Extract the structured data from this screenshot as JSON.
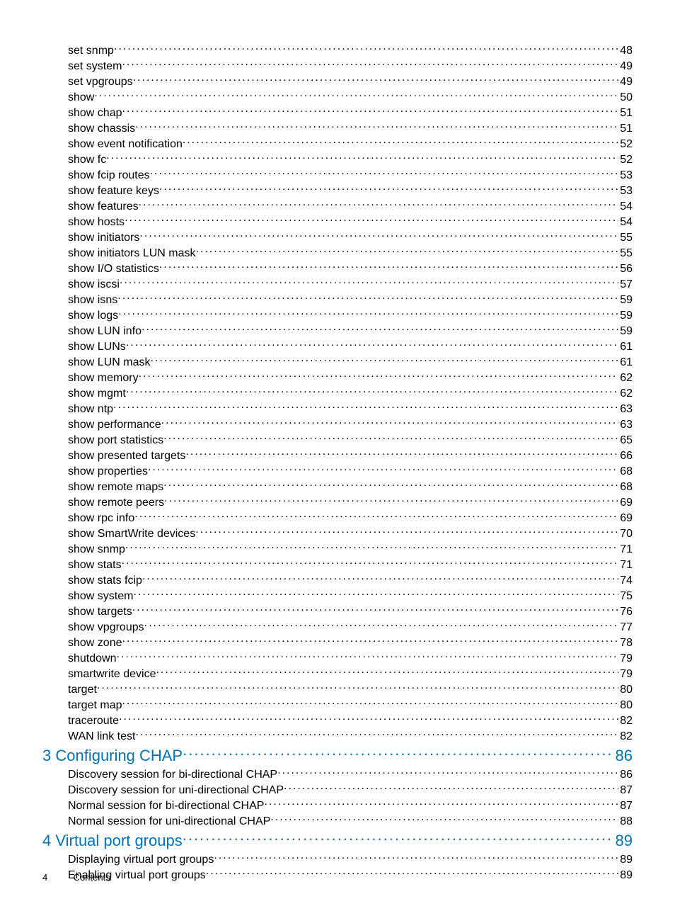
{
  "footer": {
    "page_number": "4",
    "section": "Contents"
  },
  "toc": [
    {
      "level": 1,
      "title": "set snmp",
      "page": "48"
    },
    {
      "level": 1,
      "title": "set system",
      "page": "49"
    },
    {
      "level": 1,
      "title": "set vpgroups",
      "page": "49"
    },
    {
      "level": 1,
      "title": "show",
      "page": "50"
    },
    {
      "level": 1,
      "title": "show chap",
      "page": "51"
    },
    {
      "level": 1,
      "title": "show chassis",
      "page": "51"
    },
    {
      "level": 1,
      "title": "show event notification",
      "page": "52"
    },
    {
      "level": 1,
      "title": "show fc",
      "page": "52"
    },
    {
      "level": 1,
      "title": "show fcip routes",
      "page": "53"
    },
    {
      "level": 1,
      "title": "show feature keys",
      "page": "53"
    },
    {
      "level": 1,
      "title": "show features",
      "page": "54"
    },
    {
      "level": 1,
      "title": "show hosts",
      "page": "54"
    },
    {
      "level": 1,
      "title": "show initiators",
      "page": "55"
    },
    {
      "level": 1,
      "title": "show initiators LUN mask",
      "page": "55"
    },
    {
      "level": 1,
      "title": "show I/O statistics",
      "page": "56"
    },
    {
      "level": 1,
      "title": "show iscsi",
      "page": "57"
    },
    {
      "level": 1,
      "title": "show isns",
      "page": "59"
    },
    {
      "level": 1,
      "title": "show logs",
      "page": "59"
    },
    {
      "level": 1,
      "title": "show LUN info",
      "page": "59"
    },
    {
      "level": 1,
      "title": "show LUNs",
      "page": "61"
    },
    {
      "level": 1,
      "title": "show LUN mask",
      "page": "61"
    },
    {
      "level": 1,
      "title": "show memory",
      "page": "62"
    },
    {
      "level": 1,
      "title": "show mgmt",
      "page": "62"
    },
    {
      "level": 1,
      "title": "show ntp",
      "page": "63"
    },
    {
      "level": 1,
      "title": "show performance",
      "page": "63"
    },
    {
      "level": 1,
      "title": "show port statistics",
      "page": "65"
    },
    {
      "level": 1,
      "title": "show presented targets",
      "page": "66"
    },
    {
      "level": 1,
      "title": "show properties",
      "page": "68"
    },
    {
      "level": 1,
      "title": "show remote maps",
      "page": "68"
    },
    {
      "level": 1,
      "title": "show remote peers",
      "page": "69"
    },
    {
      "level": 1,
      "title": "show rpc info",
      "page": "69"
    },
    {
      "level": 1,
      "title": "show SmartWrite devices",
      "page": "70"
    },
    {
      "level": 1,
      "title": "show snmp",
      "page": "71"
    },
    {
      "level": 1,
      "title": "show stats",
      "page": "71"
    },
    {
      "level": 1,
      "title": "show stats fcip",
      "page": "74"
    },
    {
      "level": 1,
      "title": "show system",
      "page": "75"
    },
    {
      "level": 1,
      "title": "show targets",
      "page": "76"
    },
    {
      "level": 1,
      "title": "show vpgroups",
      "page": "77"
    },
    {
      "level": 1,
      "title": "show zone",
      "page": "78"
    },
    {
      "level": 1,
      "title": "shutdown",
      "page": "79"
    },
    {
      "level": 1,
      "title": "smartwrite device",
      "page": "79"
    },
    {
      "level": 1,
      "title": "target",
      "page": "80"
    },
    {
      "level": 1,
      "title": "target map",
      "page": "80"
    },
    {
      "level": 1,
      "title": "traceroute",
      "page": "82"
    },
    {
      "level": 1,
      "title": "WAN link test",
      "page": "82"
    },
    {
      "level": 0,
      "title": "3 Configuring CHAP",
      "page": "86"
    },
    {
      "level": 1,
      "title": "Discovery session for bi-directional CHAP",
      "page": "86"
    },
    {
      "level": 1,
      "title": "Discovery session for uni-directional CHAP",
      "page": "87"
    },
    {
      "level": 1,
      "title": "Normal session for bi-directional CHAP",
      "page": "87"
    },
    {
      "level": 1,
      "title": "Normal session for uni-directional CHAP",
      "page": "88"
    },
    {
      "level": 0,
      "title": "4 Virtual port groups",
      "page": "89"
    },
    {
      "level": 1,
      "title": "Displaying virtual port groups",
      "page": "89"
    },
    {
      "level": 1,
      "title": "Enabling virtual port groups",
      "page": "89"
    }
  ]
}
